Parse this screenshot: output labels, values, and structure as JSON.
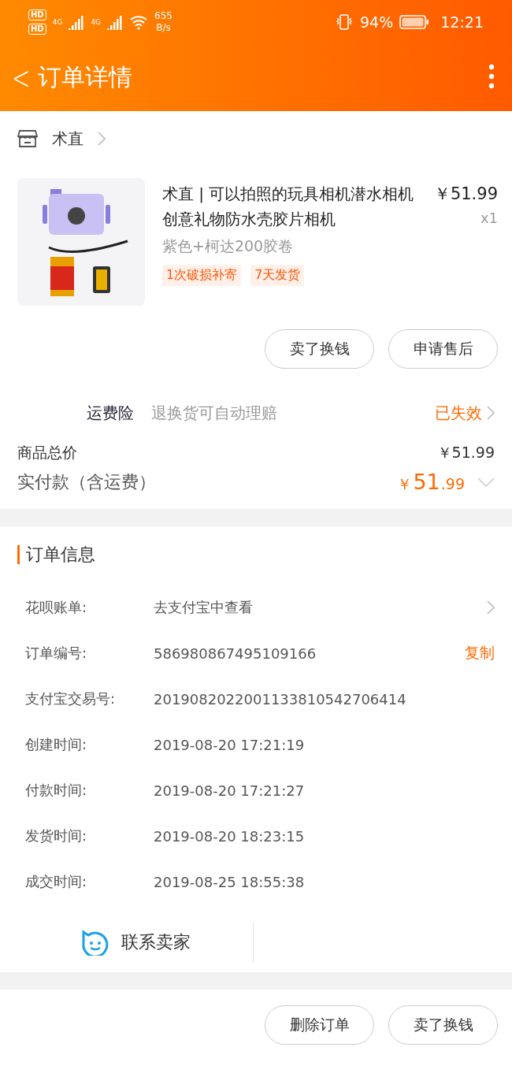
{
  "status_bar": {
    "sim_labels": [
      "HD",
      "HD"
    ],
    "network_labels": [
      "4G",
      "4G"
    ],
    "speed_value": "655",
    "speed_unit": "B/s",
    "battery": "94%",
    "time": "12:21"
  },
  "header": {
    "back": "<",
    "title": "订单详情"
  },
  "shop": {
    "name": "术直"
  },
  "product": {
    "title": "术直 | 可以拍照的玩具相机潜水相机创意礼物防水壳胶片相机",
    "price": "￥51.99",
    "quantity": "x1",
    "variant": "紫色+柯达200胶卷",
    "tags": [
      "1次破损补寄",
      "7天发货"
    ]
  },
  "item_actions": [
    "卖了换钱",
    "申请售后"
  ],
  "insurance": {
    "label": "运费险",
    "description": "退换货可自动理赔",
    "status": "已失效"
  },
  "totals": {
    "goods_label": "商品总价",
    "goods_value": "￥51.99",
    "paid_label": "实付款（含运费）",
    "paid_currency": "￥",
    "paid_integer": "51",
    "paid_decimal": ".99"
  },
  "order_info": {
    "title": "订单信息",
    "rows": [
      {
        "label": "花呗账单:",
        "value": "去支付宝中查看",
        "kind": "link"
      },
      {
        "label": "订单编号:",
        "value": "586980867495109166",
        "kind": "copy",
        "action": "复制"
      },
      {
        "label": "支付宝交易号:",
        "value": "2019082022001133810542706414",
        "kind": "plain"
      },
      {
        "label": "创建时间:",
        "value": "2019-08-20 17:21:19",
        "kind": "plain"
      },
      {
        "label": "付款时间:",
        "value": "2019-08-20 17:21:27",
        "kind": "plain"
      },
      {
        "label": "发货时间:",
        "value": "2019-08-20 18:23:15",
        "kind": "plain"
      },
      {
        "label": "成交时间:",
        "value": "2019-08-25 18:55:38",
        "kind": "plain"
      }
    ],
    "contact": "联系卖家"
  },
  "bottom_actions": [
    "删除订单",
    "卖了换钱"
  ]
}
